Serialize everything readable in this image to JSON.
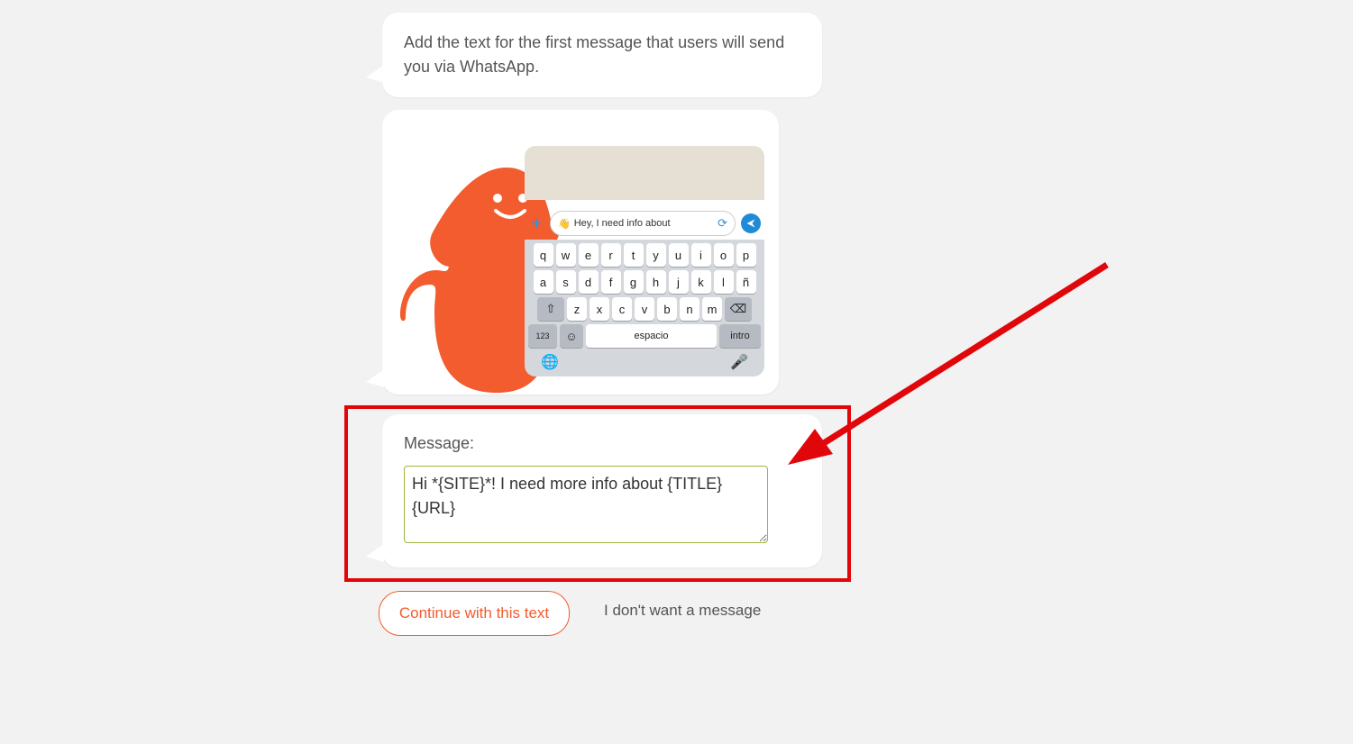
{
  "instruction": "Add the text for the first message that users will send you via WhatsApp.",
  "illustration": {
    "input_text": "Hey, I need info about",
    "keyboard": {
      "row1": [
        "q",
        "w",
        "e",
        "r",
        "t",
        "y",
        "u",
        "i",
        "o",
        "p"
      ],
      "row2": [
        "a",
        "s",
        "d",
        "f",
        "g",
        "h",
        "j",
        "k",
        "l",
        "ñ"
      ],
      "row3_mid": [
        "z",
        "x",
        "c",
        "v",
        "b",
        "n",
        "m"
      ],
      "shift": "⇧",
      "backspace": "⌫",
      "num": "123",
      "emoji": "☺",
      "space": "espacio",
      "enter": "intro",
      "globe": "🌐",
      "mic": "🎤"
    }
  },
  "message": {
    "label": "Message:",
    "value": "Hi *{SITE}*! I need more info about {TITLE} {URL}"
  },
  "actions": {
    "continue": "Continue with this text",
    "skip": "I don't want a message"
  },
  "annotation": {
    "highlight_color": "#e1060a"
  }
}
